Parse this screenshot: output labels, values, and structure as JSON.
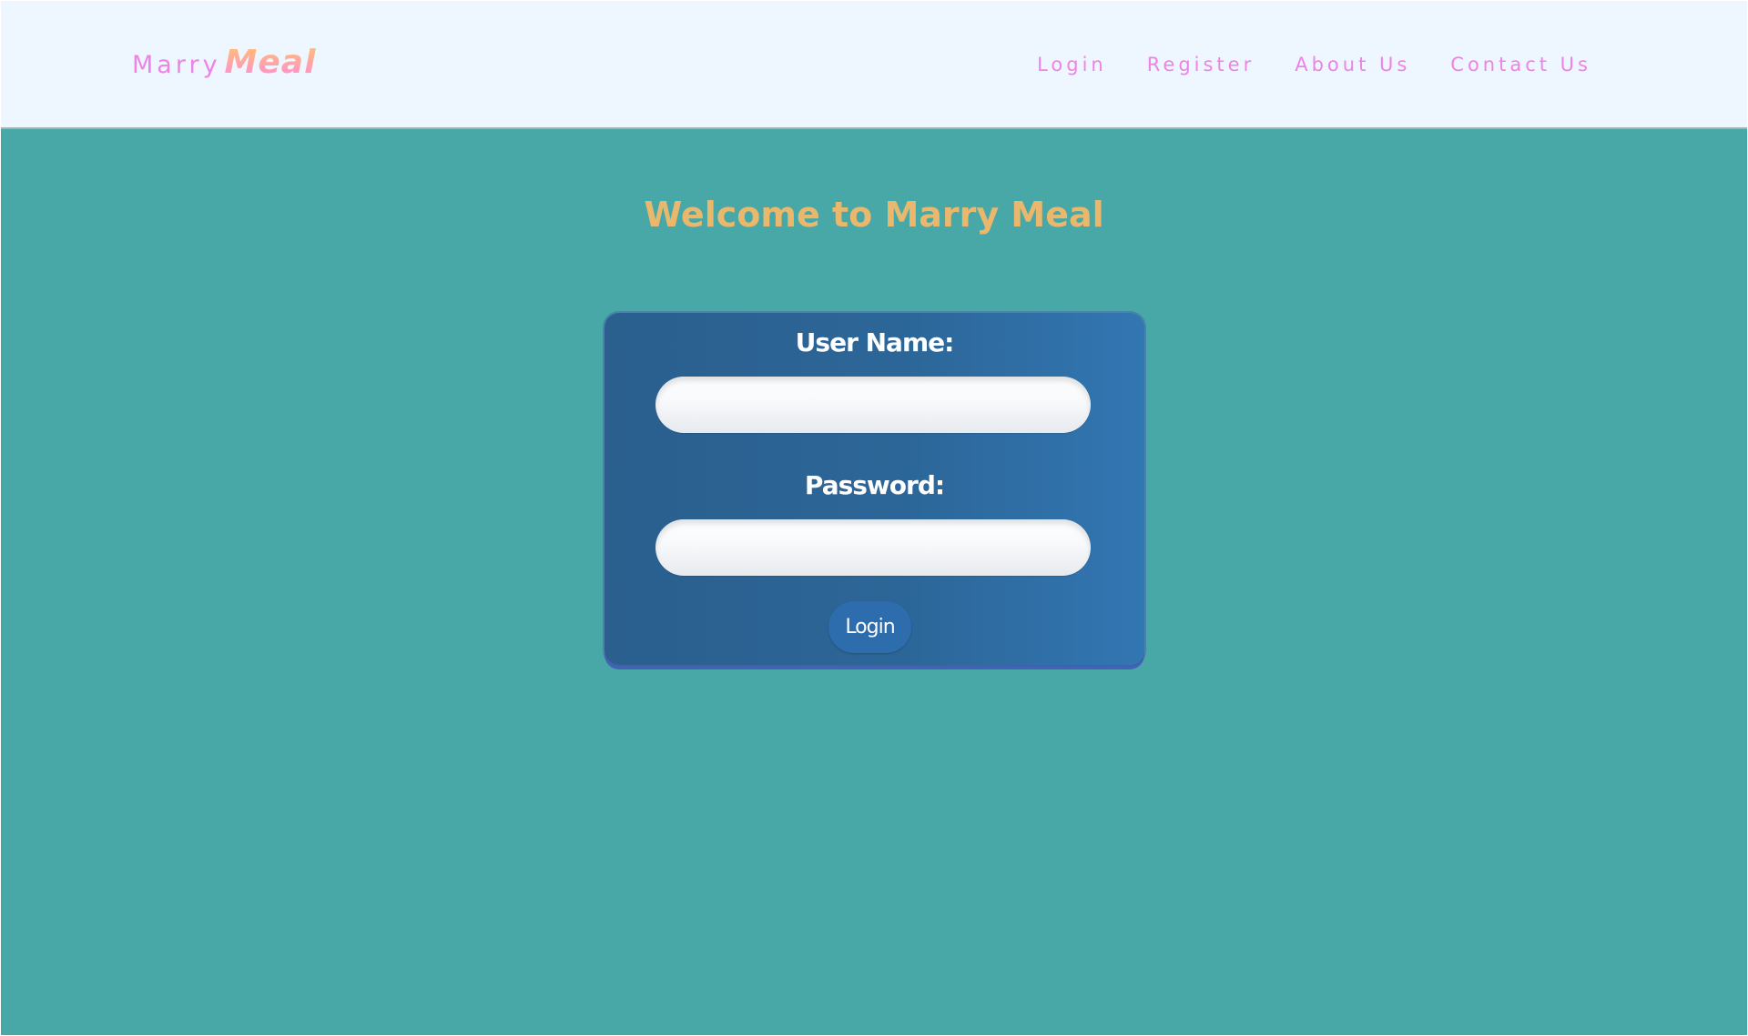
{
  "navbar": {
    "brand": {
      "part_1": "Marry",
      "part_2": "Meal"
    },
    "links": [
      {
        "label": "Login"
      },
      {
        "label": "Register"
      },
      {
        "label": "About Us"
      },
      {
        "label": "Contact Us"
      }
    ]
  },
  "main": {
    "heading": "Welcome to Marry Meal"
  },
  "login_form": {
    "username_label": "User Name:",
    "username_value": "",
    "password_label": "Password:",
    "password_value": "",
    "submit_label": "Login"
  },
  "colors": {
    "page_background": "#48a8a8",
    "navbar_background": "#eef7ff",
    "nav_link_color": "#ee82e6",
    "brand_meal_gradient_start": "#ffbe74",
    "brand_meal_gradient_end": "#ff8ed8",
    "welcome_color": "#e9b86d",
    "card_background": "#2c6698",
    "button_background": "#2d6cad"
  }
}
